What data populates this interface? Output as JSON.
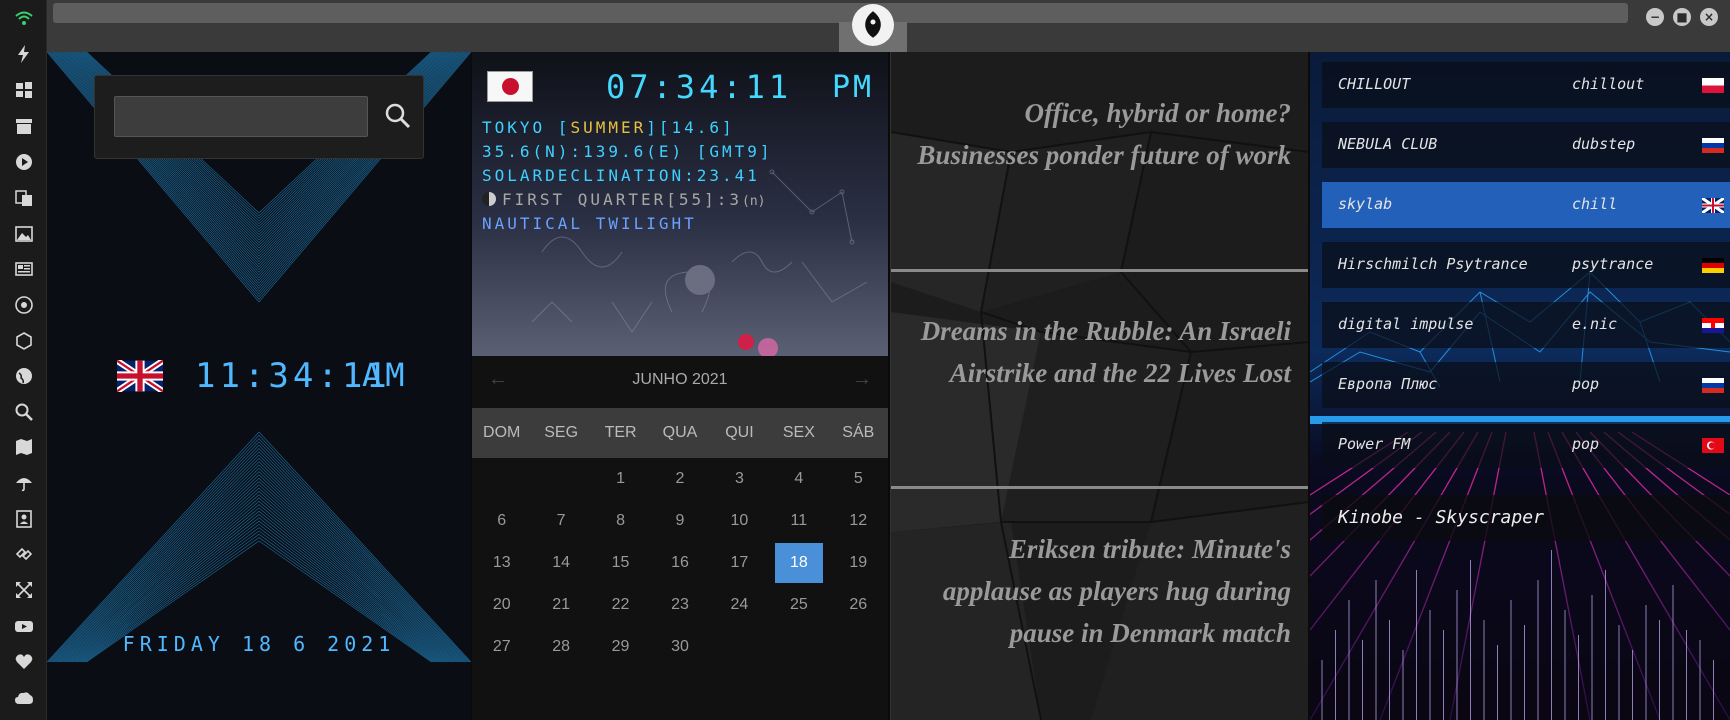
{
  "sidebar": {
    "icons": [
      "wifi-icon",
      "lightning-icon",
      "windows-icon",
      "archive-icon",
      "play-icon",
      "translate-icon",
      "image-icon",
      "news-icon",
      "radio-icon",
      "hexagon-icon",
      "globe-icon",
      "search-icon",
      "map-icon",
      "umbrella-icon",
      "contacts-icon",
      "link-icon",
      "fullscreen-icon",
      "youtube-icon",
      "heart-icon",
      "cloud-icon"
    ]
  },
  "clock": {
    "time": "11:34:11",
    "ampm": "AM",
    "date": "FRIDAY 18 6 2021",
    "search_placeholder": ""
  },
  "world": {
    "time": "07:34:11",
    "ampm": "PM",
    "line1_prefix": "TOKYO [",
    "line1_season": "SUMMER",
    "line1_suffix": "][14.6]",
    "line2": "35.6(N):139.6(E) [GMT9]",
    "line3": "SOLARDECLINATION:23.41",
    "line4": "FIRST QUARTER[55]:3",
    "line4_n": "(n)",
    "line5": "NAUTICAL TWILIGHT"
  },
  "calendar": {
    "month": "JUNHO 2021",
    "prev": "←",
    "next": "→",
    "weekdays": [
      "DOM",
      "SEG",
      "TER",
      "QUA",
      "QUI",
      "SEX",
      "SÁB"
    ],
    "leading_blanks": 2,
    "days_in_month": 30,
    "today": 18,
    "highlight_color": "#4a90d9"
  },
  "news": {
    "items": [
      "Office, hybrid or home? Businesses ponder future of work",
      "Dreams in the Rubble: An Israeli Airstrike and the 22 Lives Lost",
      "Eriksen tribute: Minute's applause as players hug during pause in Denmark match"
    ]
  },
  "radio": {
    "stations": [
      {
        "name": "CHILLOUT",
        "genre": "chillout",
        "flag": "pl"
      },
      {
        "name": "NEBULA CLUB",
        "genre": "dubstep",
        "flag": "ru"
      },
      {
        "name": "skylab",
        "genre": "chill",
        "flag": "gb"
      },
      {
        "name": "Hirschmilch Psytrance",
        "genre": "psytrance",
        "flag": "de"
      },
      {
        "name": "digital impulse",
        "genre": "e.nic",
        "flag": "hr"
      },
      {
        "name": "Европа Плюс",
        "genre": "pop",
        "flag": "ru"
      },
      {
        "name": "Power FM",
        "genre": "pop",
        "flag": "tr"
      }
    ],
    "active_index": 2,
    "now_playing": "Kinobe - Skyscraper"
  },
  "window": {
    "minimize": "−",
    "maximize": "■",
    "close": "×"
  }
}
